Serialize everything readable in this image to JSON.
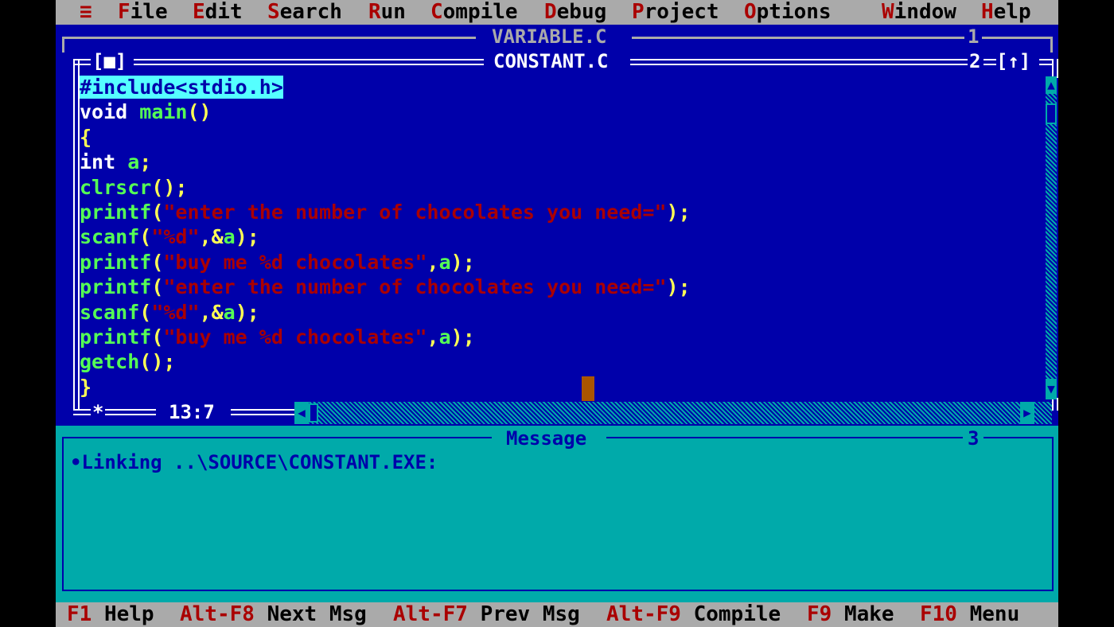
{
  "menubar": {
    "system_glyph": "≡",
    "items": [
      {
        "hot": "F",
        "rest": "ile"
      },
      {
        "hot": "E",
        "rest": "dit"
      },
      {
        "hot": "S",
        "rest": "earch"
      },
      {
        "hot": "R",
        "rest": "un"
      },
      {
        "hot": "C",
        "rest": "ompile"
      },
      {
        "hot": "D",
        "rest": "ebug"
      },
      {
        "hot": "P",
        "rest": "roject"
      },
      {
        "hot": "O",
        "rest": "ptions"
      },
      {
        "hot": "W",
        "rest": "indow"
      },
      {
        "hot": "H",
        "rest": "elp"
      }
    ]
  },
  "back_window": {
    "title": "VARIABLE.C",
    "number": "1"
  },
  "editor": {
    "close_box": "[■]",
    "title": "CONSTANT.C",
    "number": "2",
    "zoom_box": "[↑]",
    "modified_marker": "*",
    "cursor_position": "13:7",
    "lines": [
      [
        {
          "t": "#include<stdio.h>",
          "c": "sel"
        }
      ],
      [
        {
          "t": "void ",
          "c": "c-w"
        },
        {
          "t": "main",
          "c": "c-g"
        },
        {
          "t": "()",
          "c": "c-y"
        }
      ],
      [
        {
          "t": "{",
          "c": "c-y"
        }
      ],
      [
        {
          "t": "int ",
          "c": "c-w"
        },
        {
          "t": "a",
          "c": "c-g"
        },
        {
          "t": ";",
          "c": "c-y"
        }
      ],
      [
        {
          "t": "clrscr",
          "c": "c-g"
        },
        {
          "t": "();",
          "c": "c-y"
        }
      ],
      [
        {
          "t": "printf",
          "c": "c-g"
        },
        {
          "t": "(",
          "c": "c-y"
        },
        {
          "t": "\"enter the number of chocolates you need=\"",
          "c": "c-r"
        },
        {
          "t": ");",
          "c": "c-y"
        }
      ],
      [
        {
          "t": "scanf",
          "c": "c-g"
        },
        {
          "t": "(",
          "c": "c-y"
        },
        {
          "t": "\"%d\"",
          "c": "c-r"
        },
        {
          "t": ",&",
          "c": "c-y"
        },
        {
          "t": "a",
          "c": "c-g"
        },
        {
          "t": ");",
          "c": "c-y"
        }
      ],
      [
        {
          "t": "printf",
          "c": "c-g"
        },
        {
          "t": "(",
          "c": "c-y"
        },
        {
          "t": "\"buy me %d chocolates\"",
          "c": "c-r"
        },
        {
          "t": ",",
          "c": "c-y"
        },
        {
          "t": "a",
          "c": "c-g"
        },
        {
          "t": ");",
          "c": "c-y"
        }
      ],
      [
        {
          "t": "printf",
          "c": "c-g"
        },
        {
          "t": "(",
          "c": "c-y"
        },
        {
          "t": "\"enter the number of chocolates you need=\"",
          "c": "c-r"
        },
        {
          "t": ");",
          "c": "c-y"
        }
      ],
      [
        {
          "t": "scanf",
          "c": "c-g"
        },
        {
          "t": "(",
          "c": "c-y"
        },
        {
          "t": "\"%d\"",
          "c": "c-r"
        },
        {
          "t": ",&",
          "c": "c-y"
        },
        {
          "t": "a",
          "c": "c-g"
        },
        {
          "t": ");",
          "c": "c-y"
        }
      ],
      [
        {
          "t": "printf",
          "c": "c-g"
        },
        {
          "t": "(",
          "c": "c-y"
        },
        {
          "t": "\"buy me %d chocolates\"",
          "c": "c-r"
        },
        {
          "t": ",",
          "c": "c-y"
        },
        {
          "t": "a",
          "c": "c-g"
        },
        {
          "t": ");",
          "c": "c-y"
        }
      ],
      [
        {
          "t": "getch",
          "c": "c-g"
        },
        {
          "t": "();",
          "c": "c-y"
        }
      ],
      [
        {
          "t": "}",
          "c": "c-y"
        }
      ]
    ]
  },
  "message_window": {
    "title": "Message",
    "number": "3",
    "text": "•Linking ..\\SOURCE\\CONSTANT.EXE:"
  },
  "statusbar": {
    "items": [
      {
        "key": "F1",
        "label": "Help"
      },
      {
        "key": "Alt-F8",
        "label": "Next Msg"
      },
      {
        "key": "Alt-F7",
        "label": "Prev Msg"
      },
      {
        "key": "Alt-F9",
        "label": "Compile"
      },
      {
        "key": "F9",
        "label": "Make"
      },
      {
        "key": "F10",
        "label": "Menu"
      }
    ]
  },
  "colors": {
    "desktop_blue": "#0000AA",
    "menu_gray": "#AAAAAA",
    "hotkey_red": "#AA0000",
    "string_red": "#AA0000",
    "identifier_green": "#55FF55",
    "punct_yellow": "#FFFF55",
    "keyword_white": "#FFFFFF",
    "message_cyan": "#00AAAA",
    "selection_cyan": "#55FFFF",
    "cursor_orange": "#AA5500"
  }
}
